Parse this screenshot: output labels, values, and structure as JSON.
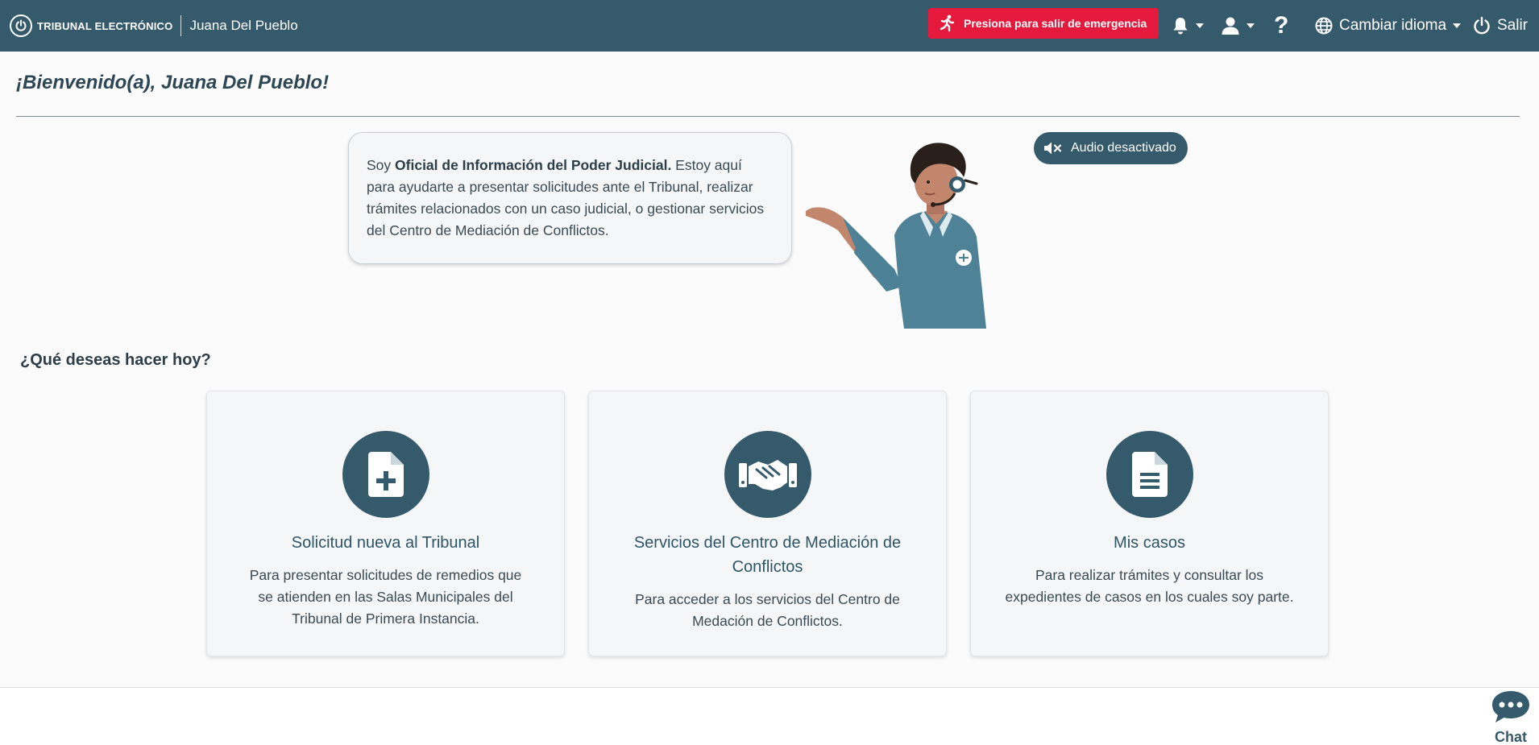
{
  "header": {
    "brand": "TRIBUNAL ELECTRÓNICO",
    "user_name": "Juana Del Pueblo",
    "emergency_label": "Presiona para salir de emergencia",
    "help_label": "?",
    "language_label": "Cambiar idioma",
    "exit_label": "Salir",
    "icons": [
      "power-icon",
      "running-person-icon",
      "bell-icon",
      "user-icon",
      "question-icon",
      "globe-icon",
      "power-icon"
    ]
  },
  "welcome": "¡Bienvenido(a), Juana Del Pueblo!",
  "assistant": {
    "intro_prefix": "Soy ",
    "intro_bold": "Oficial de Información del Poder Judicial.",
    "intro_rest": " Estoy aquí para ayudarte a presentar solicitudes ante el Tribunal, realizar trámites relacionados con un caso judicial, o gestionar servicios del Centro de Mediación de Conflictos.",
    "audio_label": "Audio desactivado"
  },
  "question": "¿Qué deseas hacer hoy?",
  "cards": [
    {
      "icon": "file-plus-icon",
      "title": "Solicitud nueva al Tribunal",
      "description": "Para presentar solicitudes de remedios que se atienden en las Salas Municipales del Tribunal de Primera Instancia."
    },
    {
      "icon": "handshake-icon",
      "title": "Servicios del Centro de Mediación de Conflictos",
      "description": "Para acceder a los servicios del Centro de Medación de Conflictos."
    },
    {
      "icon": "document-icon",
      "title": "Mis casos",
      "description": "Para realizar trámites y consultar los expedientes de casos en los cuales soy parte."
    }
  ],
  "chat_label": "Chat",
  "colors": {
    "header_bg": "#355a6b",
    "emergency_bg": "#e4193b",
    "accent": "#355a6b",
    "card_bg": "#f4f6f8"
  }
}
